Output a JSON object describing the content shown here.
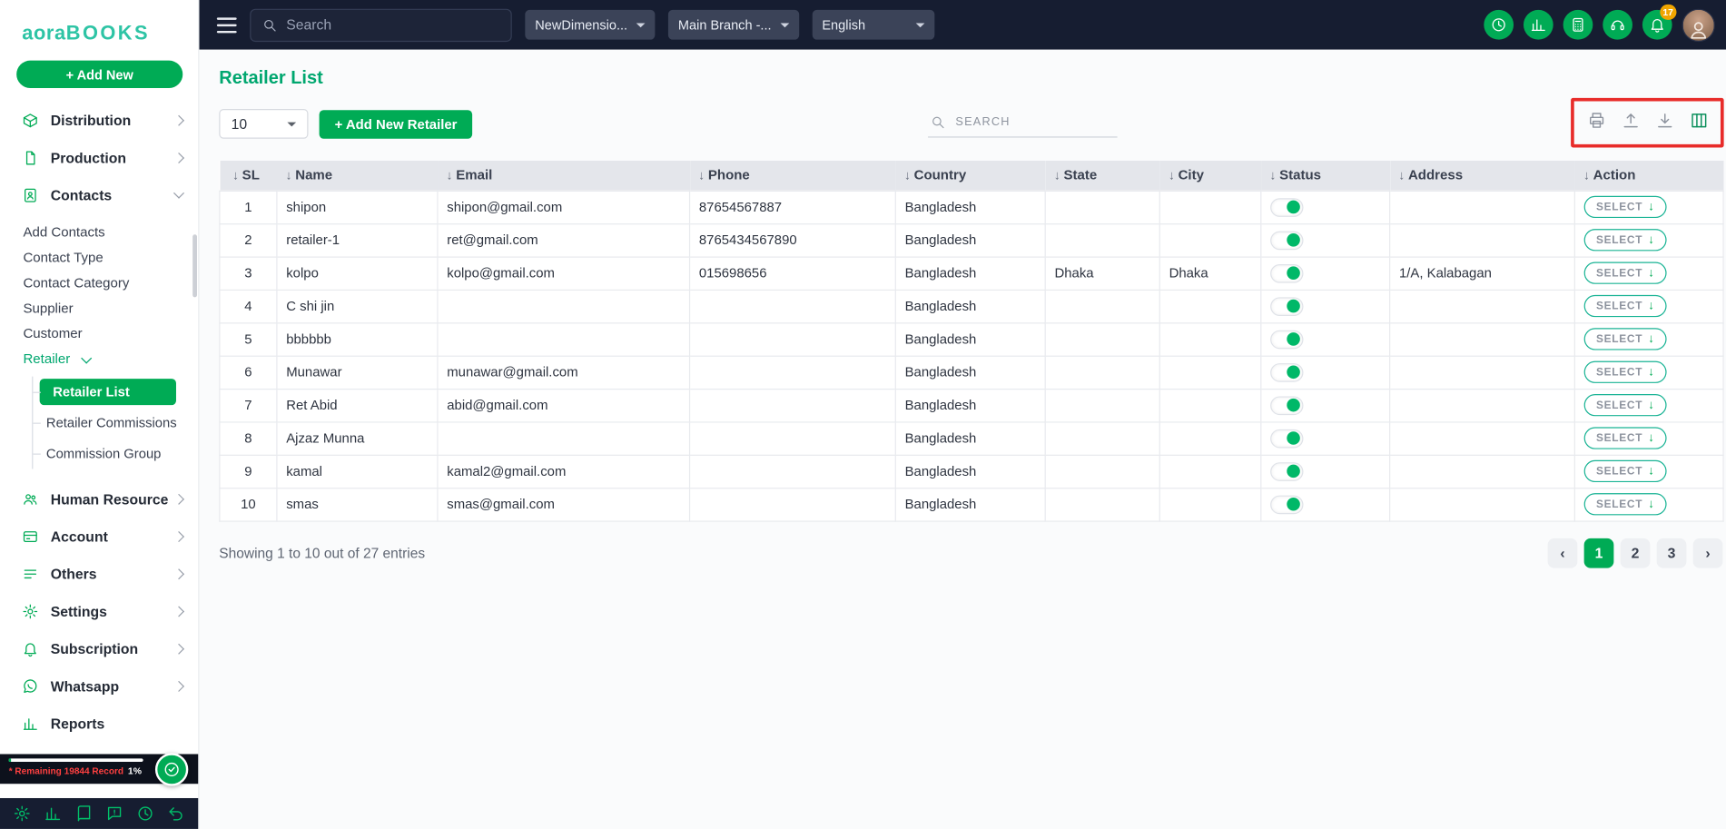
{
  "accent_color": "#00ab55",
  "brand": {
    "logo_aora": "aora",
    "logo_books": "BOOKS",
    "add_new_label": "+ Add New"
  },
  "topbar": {
    "search_placeholder": "Search",
    "company_dropdown": "NewDimensio...",
    "branch_dropdown": "Main Branch -...",
    "language_dropdown": "English",
    "notification_count": "17",
    "action_icons": [
      {
        "name": "history-button",
        "icon": "history-icon",
        "glyph": "clock"
      },
      {
        "name": "analytics-button",
        "icon": "bar-chart-icon",
        "glyph": "chart"
      },
      {
        "name": "calculator-button",
        "icon": "calculator-icon",
        "glyph": "calculator"
      },
      {
        "name": "support-button",
        "icon": "headset-icon",
        "glyph": "headset"
      }
    ]
  },
  "sidebar": {
    "items": [
      {
        "label": "Distribution",
        "icon": "distribution-icon",
        "glyph": "box",
        "chevron": "right"
      },
      {
        "label": "Production",
        "icon": "production-icon",
        "glyph": "doc",
        "chevron": "right"
      },
      {
        "label": "Contacts",
        "icon": "contacts-icon",
        "glyph": "contacts",
        "chevron": "down"
      },
      {
        "label": "Human Resource",
        "icon": "human-resource-icon",
        "glyph": "people",
        "chevron": "right"
      },
      {
        "label": "Account",
        "icon": "account-icon",
        "glyph": "card",
        "chevron": "right"
      },
      {
        "label": "Others",
        "icon": "others-icon",
        "glyph": "lines",
        "chevron": "right"
      },
      {
        "label": "Settings",
        "icon": "settings-icon",
        "glyph": "gear",
        "chevron": "right"
      },
      {
        "label": "Subscription",
        "icon": "subscription-icon",
        "glyph": "bell",
        "chevron": "right"
      },
      {
        "label": "Whatsapp",
        "icon": "whatsapp-icon",
        "glyph": "whatsapp",
        "chevron": "right"
      },
      {
        "label": "Reports",
        "icon": "reports-icon",
        "glyph": "chart",
        "chevron": "none"
      }
    ],
    "contacts_children": [
      "Add Contacts",
      "Contact Type",
      "Contact Category",
      "Supplier",
      "Customer"
    ],
    "retailer_group": {
      "label": "Retailer",
      "children": [
        "Retailer List",
        "Retailer Commissions",
        "Commission Group"
      ],
      "active_child": "Retailer List"
    },
    "footer_note": {
      "text": "* Remaining 19844 Record",
      "percent": "1%"
    },
    "footer_icons": [
      {
        "name": "footer-settings-button",
        "icon": "gear-icon",
        "glyph": "gear"
      },
      {
        "name": "footer-reports-button",
        "icon": "bar-chart-icon",
        "glyph": "chart"
      },
      {
        "name": "footer-ledger-button",
        "icon": "book-icon",
        "glyph": "book"
      },
      {
        "name": "footer-support-button",
        "icon": "chat-icon",
        "glyph": "chat"
      },
      {
        "name": "footer-history-button",
        "icon": "clock-icon",
        "glyph": "clock"
      },
      {
        "name": "footer-undo-button",
        "icon": "undo-icon",
        "glyph": "undo"
      }
    ]
  },
  "page": {
    "title": "Retailer List",
    "page_size_value": "10",
    "add_retailer_label": "+ Add New Retailer",
    "search_placeholder": "SEARCH",
    "entries_summary": "Showing 1 to 10 out of 27 entries",
    "pagination": {
      "pages": [
        "1",
        "2",
        "3"
      ],
      "active": "1",
      "prev_icon": "chevron-left-icon",
      "next_icon": "chevron-right-icon"
    }
  },
  "table": {
    "headers": [
      "SL",
      "Name",
      "Email",
      "Phone",
      "Country",
      "State",
      "City",
      "Status",
      "Address",
      "Action"
    ],
    "select_label": "SELECT",
    "rows": [
      {
        "sl": "1",
        "name": "shipon",
        "email": "shipon@gmail.com",
        "phone": "87654567887",
        "country": "Bangladesh",
        "state": "",
        "city": "",
        "status": "on",
        "address": ""
      },
      {
        "sl": "2",
        "name": "retailer-1",
        "email": "ret@gmail.com",
        "phone": "8765434567890",
        "country": "Bangladesh",
        "state": "",
        "city": "",
        "status": "on",
        "address": ""
      },
      {
        "sl": "3",
        "name": "kolpo",
        "email": "kolpo@gmail.com",
        "phone": "015698656",
        "country": "Bangladesh",
        "state": "Dhaka",
        "city": "Dhaka",
        "status": "on",
        "address": "1/A, Kalabagan"
      },
      {
        "sl": "4",
        "name": "C shi jin",
        "email": "",
        "phone": "",
        "country": "Bangladesh",
        "state": "",
        "city": "",
        "status": "on",
        "address": ""
      },
      {
        "sl": "5",
        "name": "bbbbbb",
        "email": "",
        "phone": "",
        "country": "Bangladesh",
        "state": "",
        "city": "",
        "status": "on",
        "address": ""
      },
      {
        "sl": "6",
        "name": "Munawar",
        "email": "munawar@gmail.com",
        "phone": "",
        "country": "Bangladesh",
        "state": "",
        "city": "",
        "status": "on",
        "address": ""
      },
      {
        "sl": "7",
        "name": "Ret Abid",
        "email": "abid@gmail.com",
        "phone": "",
        "country": "Bangladesh",
        "state": "",
        "city": "",
        "status": "on",
        "address": ""
      },
      {
        "sl": "8",
        "name": "Ajzaz Munna",
        "email": "",
        "phone": "",
        "country": "Bangladesh",
        "state": "",
        "city": "",
        "status": "on",
        "address": ""
      },
      {
        "sl": "9",
        "name": "kamal",
        "email": "kamal2@gmail.com",
        "phone": "",
        "country": "Bangladesh",
        "state": "",
        "city": "",
        "status": "on",
        "address": ""
      },
      {
        "sl": "10",
        "name": "smas",
        "email": "smas@gmail.com",
        "phone": "",
        "country": "Bangladesh",
        "state": "",
        "city": "",
        "status": "on",
        "address": ""
      }
    ]
  },
  "annotation": {
    "color": "#e82c2a"
  }
}
